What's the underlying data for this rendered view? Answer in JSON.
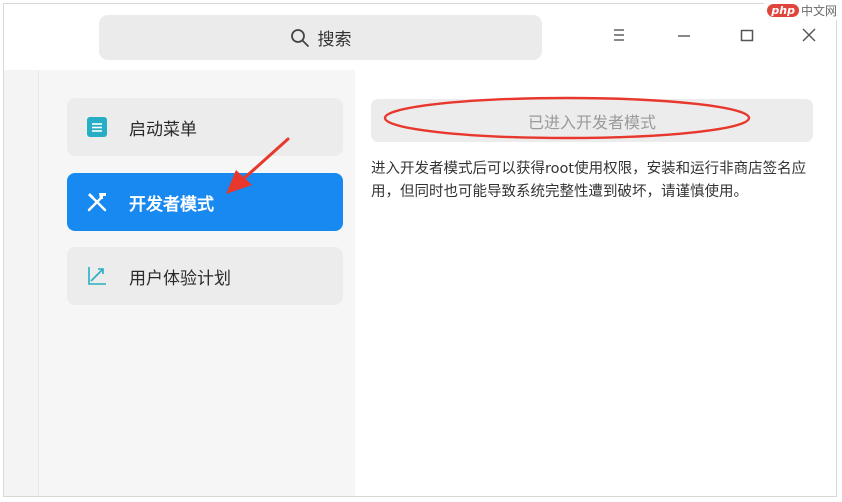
{
  "search": {
    "label": "搜索"
  },
  "watermark": {
    "brand": "php",
    "site": "中文网"
  },
  "sidebar": {
    "items": [
      {
        "label": "启动菜单",
        "icon": "boot-menu-icon",
        "active": false
      },
      {
        "label": "开发者模式",
        "icon": "developer-tools-icon",
        "active": true
      },
      {
        "label": "用户体验计划",
        "icon": "trend-chart-icon",
        "active": false
      }
    ]
  },
  "content": {
    "status_button": "已进入开发者模式",
    "description": "进入开发者模式后可以获得root使用权限，安装和运行非商店签名应用，但同时也可能导致系统完整性遭到破坏，请谨慎使用。"
  },
  "colors": {
    "accent": "#1889f0",
    "annotation": "#e8372c",
    "boot_icon": "#27aec4"
  }
}
